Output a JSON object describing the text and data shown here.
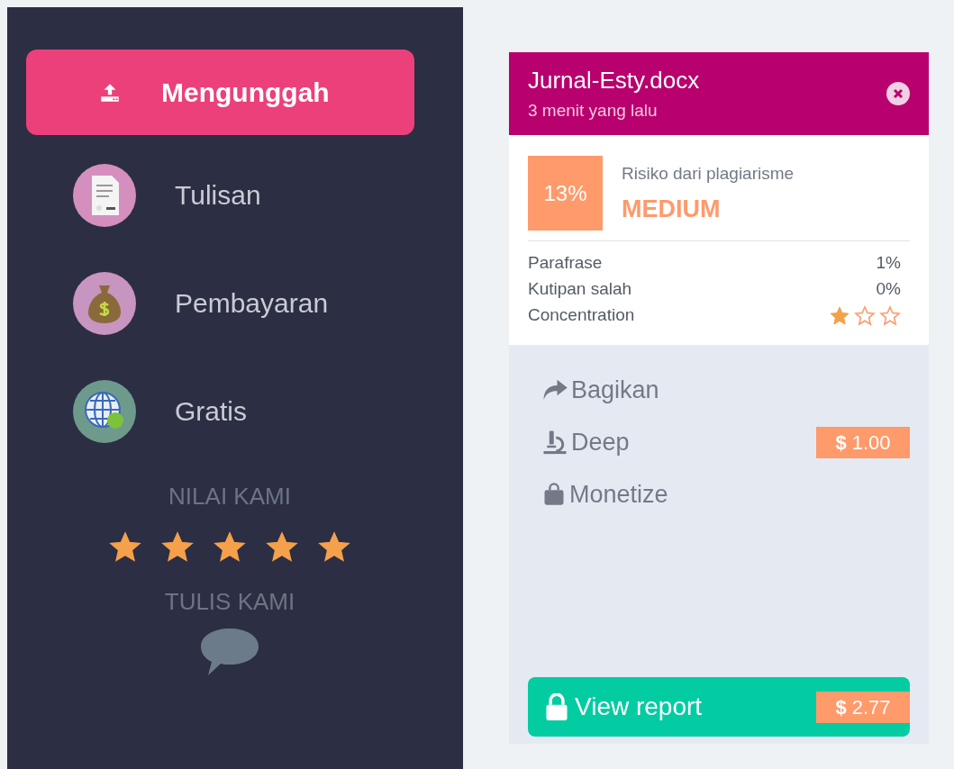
{
  "sidebar": {
    "items": [
      {
        "label": "Mengunggah",
        "kind": "upload",
        "selected": true
      },
      {
        "label": "Tulisan",
        "kind": "document",
        "selected": false
      },
      {
        "label": "Pembayaran",
        "kind": "money",
        "selected": false
      },
      {
        "label": "Gratis",
        "kind": "globe",
        "selected": false
      }
    ],
    "rating": {
      "label": "NILAI KAMI",
      "stars": 5
    },
    "write_us": {
      "label": "TULIS KAMI"
    }
  },
  "card": {
    "file_name": "Jurnal-Esty.docx",
    "time": "3 menit yang lalu",
    "risk": {
      "percent": "13%",
      "label": "Risiko dari plagiarisme",
      "level_text": "MEDIUM"
    },
    "metrics": [
      {
        "kind": "value",
        "label": "Parafrase",
        "value": "1%"
      },
      {
        "kind": "value",
        "label": "Kutipan salah",
        "value": "0%"
      },
      {
        "kind": "stars",
        "label": "Concentration",
        "stars": 1
      }
    ],
    "actions": [
      {
        "kind": "share",
        "label": "Bagikan"
      },
      {
        "kind": "microscope",
        "label": "Deep",
        "price": "**$** 1.00"
      },
      {
        "kind": "bag",
        "label": "Monetize"
      }
    ],
    "report_button": {
      "label": "View report",
      "price": "**$** 2.77"
    }
  }
}
